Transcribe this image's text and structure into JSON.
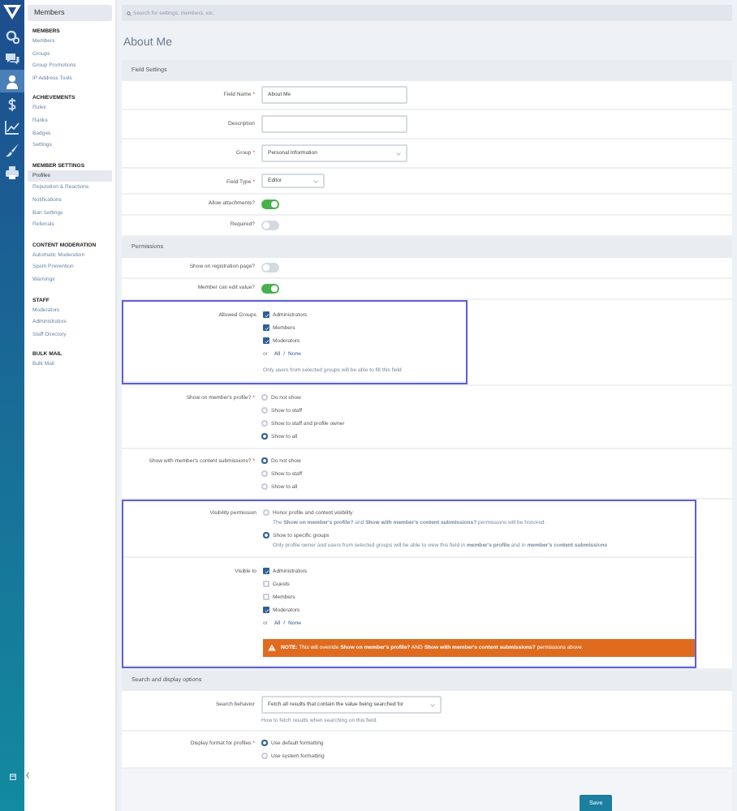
{
  "nav_rail": [
    {
      "selected": false
    },
    {
      "selected": false
    },
    {
      "selected": true
    },
    {
      "selected": false
    },
    {
      "selected": false
    },
    {
      "selected": false
    },
    {
      "selected": false
    }
  ],
  "sidebar": {
    "title": "Members",
    "sections": [
      {
        "heading": "MEMBERS",
        "items": [
          {
            "label": "Members",
            "selected": false
          },
          {
            "label": "Groups",
            "selected": false
          },
          {
            "label": "Group Promotions",
            "selected": false
          },
          {
            "label": "IP Address Tools",
            "selected": false
          }
        ]
      },
      {
        "heading": "ACHIEVEMENTS",
        "items": [
          {
            "label": "Rules",
            "selected": false
          },
          {
            "label": "Ranks",
            "selected": false
          },
          {
            "label": "Badges",
            "selected": false
          },
          {
            "label": "Settings",
            "selected": false
          }
        ]
      },
      {
        "heading": "MEMBER SETTINGS",
        "items": [
          {
            "label": "Profiles",
            "selected": true
          },
          {
            "label": "Reputation & Reactions",
            "selected": false
          },
          {
            "label": "Notifications",
            "selected": false
          },
          {
            "label": "Ban Settings",
            "selected": false
          },
          {
            "label": "Referrals",
            "selected": false
          }
        ]
      },
      {
        "heading": "CONTENT MODERATION",
        "items": [
          {
            "label": "Automatic Moderation",
            "selected": false
          },
          {
            "label": "Spam Prevention",
            "selected": false
          },
          {
            "label": "Warnings",
            "selected": false
          }
        ]
      },
      {
        "heading": "STAFF",
        "items": [
          {
            "label": "Moderators",
            "selected": false
          },
          {
            "label": "Administrators",
            "selected": false
          },
          {
            "label": "Staff Directory",
            "selected": false
          }
        ]
      },
      {
        "heading": "BULK MAIL",
        "items": [
          {
            "label": "Bulk Mail",
            "selected": false
          }
        ]
      }
    ]
  },
  "search": {
    "placeholder": "Search for settings, members, etc."
  },
  "page_title": "About Me",
  "sections": [
    {
      "title": "Field Settings",
      "rows": [
        {
          "kind": "text",
          "label": "Field Name",
          "required_mark": "*",
          "value": "About Me"
        },
        {
          "kind": "text",
          "label": "Description"
        },
        {
          "kind": "select",
          "label": "Group",
          "required_mark": "*",
          "value": "Personal Information"
        },
        {
          "kind": "short-select",
          "label": "Field Type",
          "required_mark": "*",
          "value": "Editor"
        },
        {
          "kind": "toggle",
          "label": "Allow attachments?",
          "on": true
        },
        {
          "kind": "toggle",
          "label": "Required?",
          "on": false
        }
      ]
    },
    {
      "title": "Permissions",
      "rows": [
        {
          "kind": "toggle",
          "label": "Show on registration page?",
          "on": false
        },
        {
          "kind": "toggle",
          "label": "Member can edit value?",
          "on": true
        },
        {
          "kind": "highlight",
          "rows": [
            {
              "kind": "checkboxes",
              "label": "Allowed Groups",
              "options": [
                {
                  "label": "Administrators",
                  "checked": true
                },
                {
                  "label": "Members",
                  "checked": true
                },
                {
                  "label": "Moderators",
                  "checked": true
                }
              ],
              "or": "or",
              "all": "All",
              "sep": "/",
              "none": "None",
              "hint": "Only users from selected groups will be able to fill this field"
            }
          ]
        },
        {
          "kind": "radios",
          "label": "Show on member's profile?",
          "required_mark": "*",
          "options": [
            {
              "label": "Do not show",
              "selected": false
            },
            {
              "label": "Show to staff",
              "selected": false
            },
            {
              "label": "Show to staff and profile owner",
              "selected": false
            },
            {
              "label": "Show to all",
              "selected": true
            }
          ]
        },
        {
          "kind": "radios",
          "label": "Show with member's content submissions?",
          "required_mark": "*",
          "options": [
            {
              "label": "Do not show",
              "selected": true
            },
            {
              "label": "Show to staff",
              "selected": false
            },
            {
              "label": "Show to all",
              "selected": false
            }
          ]
        },
        {
          "kind": "highlight",
          "rows": [
            {
              "kind": "radios",
              "label": "Visibility permission",
              "options": [
                {
                  "label": "Honor profile and content visibility",
                  "selected": false,
                  "hint": "The **Show on member's profile?** and **Show with member's content submissions?** permissions will be honored."
                },
                {
                  "label": "Show to specific groups",
                  "selected": true,
                  "hint": "Only profile owner and users from selected groups will be able to view this field in **member's profile** and in **member's content submissions**"
                }
              ]
            },
            {
              "kind": "checkboxes",
              "label": "Visible to",
              "options": [
                {
                  "label": "Administrators",
                  "checked": true
                },
                {
                  "label": "Guests",
                  "checked": false
                },
                {
                  "label": "Members",
                  "checked": false
                },
                {
                  "label": "Moderators",
                  "checked": true
                }
              ],
              "or": "or",
              "all": "All",
              "sep": "/",
              "none": "None",
              "note": "**NOTE:** This will override **Show on member's profile?** AND **Show with member's content submissions?** permissions above."
            }
          ]
        }
      ]
    },
    {
      "title": "Search and display options",
      "rows": [
        {
          "kind": "long-select",
          "label": "Search behavior",
          "value": "Fetch all results that contain the value being searched for",
          "hint": "How to fetch results when searching on this field."
        },
        {
          "kind": "radios",
          "label": "Display format for profiles",
          "required_mark": "*",
          "options": [
            {
              "label": "Use default formatting",
              "selected": true
            },
            {
              "label": "Use system formatting",
              "selected": false
            }
          ]
        }
      ]
    }
  ],
  "save_button": "Save"
}
